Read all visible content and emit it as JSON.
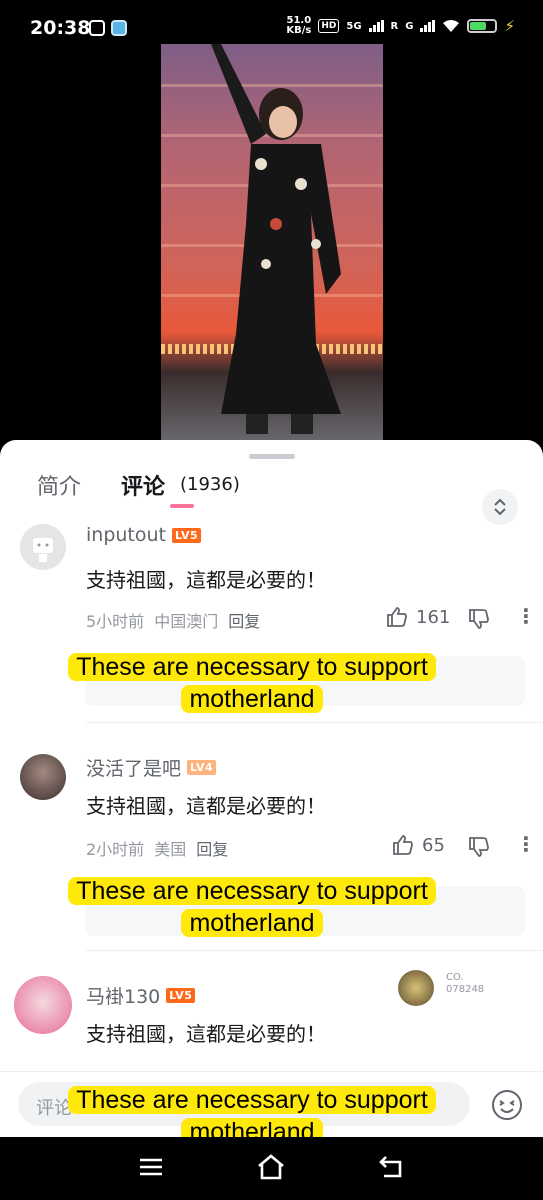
{
  "status_bar": {
    "time": "20:38",
    "speed_value": "51.0",
    "speed_unit": "KB/s",
    "hd": "HD",
    "net1": "5G",
    "net2": "R",
    "net3": "G"
  },
  "sheet": {
    "tabs": [
      {
        "label": "简介"
      },
      {
        "label": "评论"
      }
    ],
    "comment_count": "(1936)"
  },
  "comments": [
    {
      "username": "inputout",
      "level": "LV5",
      "text": "支持祖國，這都是必要的！",
      "time": "5小时前",
      "location": "中国澳门",
      "reply_label": "回复",
      "likes": "161"
    },
    {
      "username": "没活了是吧",
      "level": "LV4",
      "text": "支持祖國，這都是必要的！",
      "time": "2小时前",
      "location": "美国",
      "reply_label": "回复",
      "likes": "65"
    },
    {
      "username": "马褂130",
      "level": "LV5",
      "text": "支持祖國，這都是必要的！",
      "badge_text": "CO. 078248"
    }
  ],
  "caption": {
    "line1": "These are necessary to support",
    "line2": "motherland"
  },
  "input": {
    "placeholder": "评论"
  },
  "colors": {
    "accent": "#fb7299",
    "caption_bg": "#ffe90a",
    "lv5": "#ff6a1a",
    "lv4": "#ffb37c"
  },
  "icons": [
    "menu-icon",
    "home-icon",
    "back-icon",
    "thumb-up-icon",
    "thumb-down-icon",
    "more-icon",
    "emoji-icon",
    "expand-icon"
  ]
}
